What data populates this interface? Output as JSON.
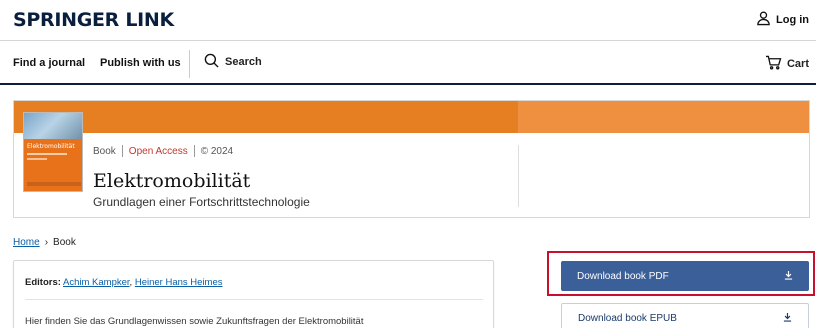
{
  "header": {
    "logo": "SPRINGER LINK",
    "login_label": "Log in"
  },
  "nav": {
    "find_journal": "Find a journal",
    "publish": "Publish with us",
    "search": "Search",
    "cart": "Cart"
  },
  "book": {
    "cover_title": "Elektromobilität",
    "type": "Book",
    "access": "Open Access",
    "year": "© 2024",
    "title": "Elektromobilität",
    "subtitle": "Grundlagen einer Fortschrittstechnologie"
  },
  "breadcrumb": {
    "home": "Home",
    "separator": "›",
    "current": "Book"
  },
  "editors": {
    "label": "Editors:",
    "editor1": "Achim Kampker",
    "comma": ", ",
    "editor2": "Heiner Hans Heimes",
    "description": "Hier finden Sie das Grundlagenwissen sowie Zukunftsfragen der Elektromobilität"
  },
  "downloads": {
    "pdf": "Download book PDF",
    "epub": "Download book EPUB"
  },
  "colors": {
    "brand_navy": "#0a1f3d",
    "orange": "#e67e22",
    "button_blue": "#3b5f99",
    "highlight_red": "#c8102e",
    "link_blue": "#0b5fa5"
  }
}
